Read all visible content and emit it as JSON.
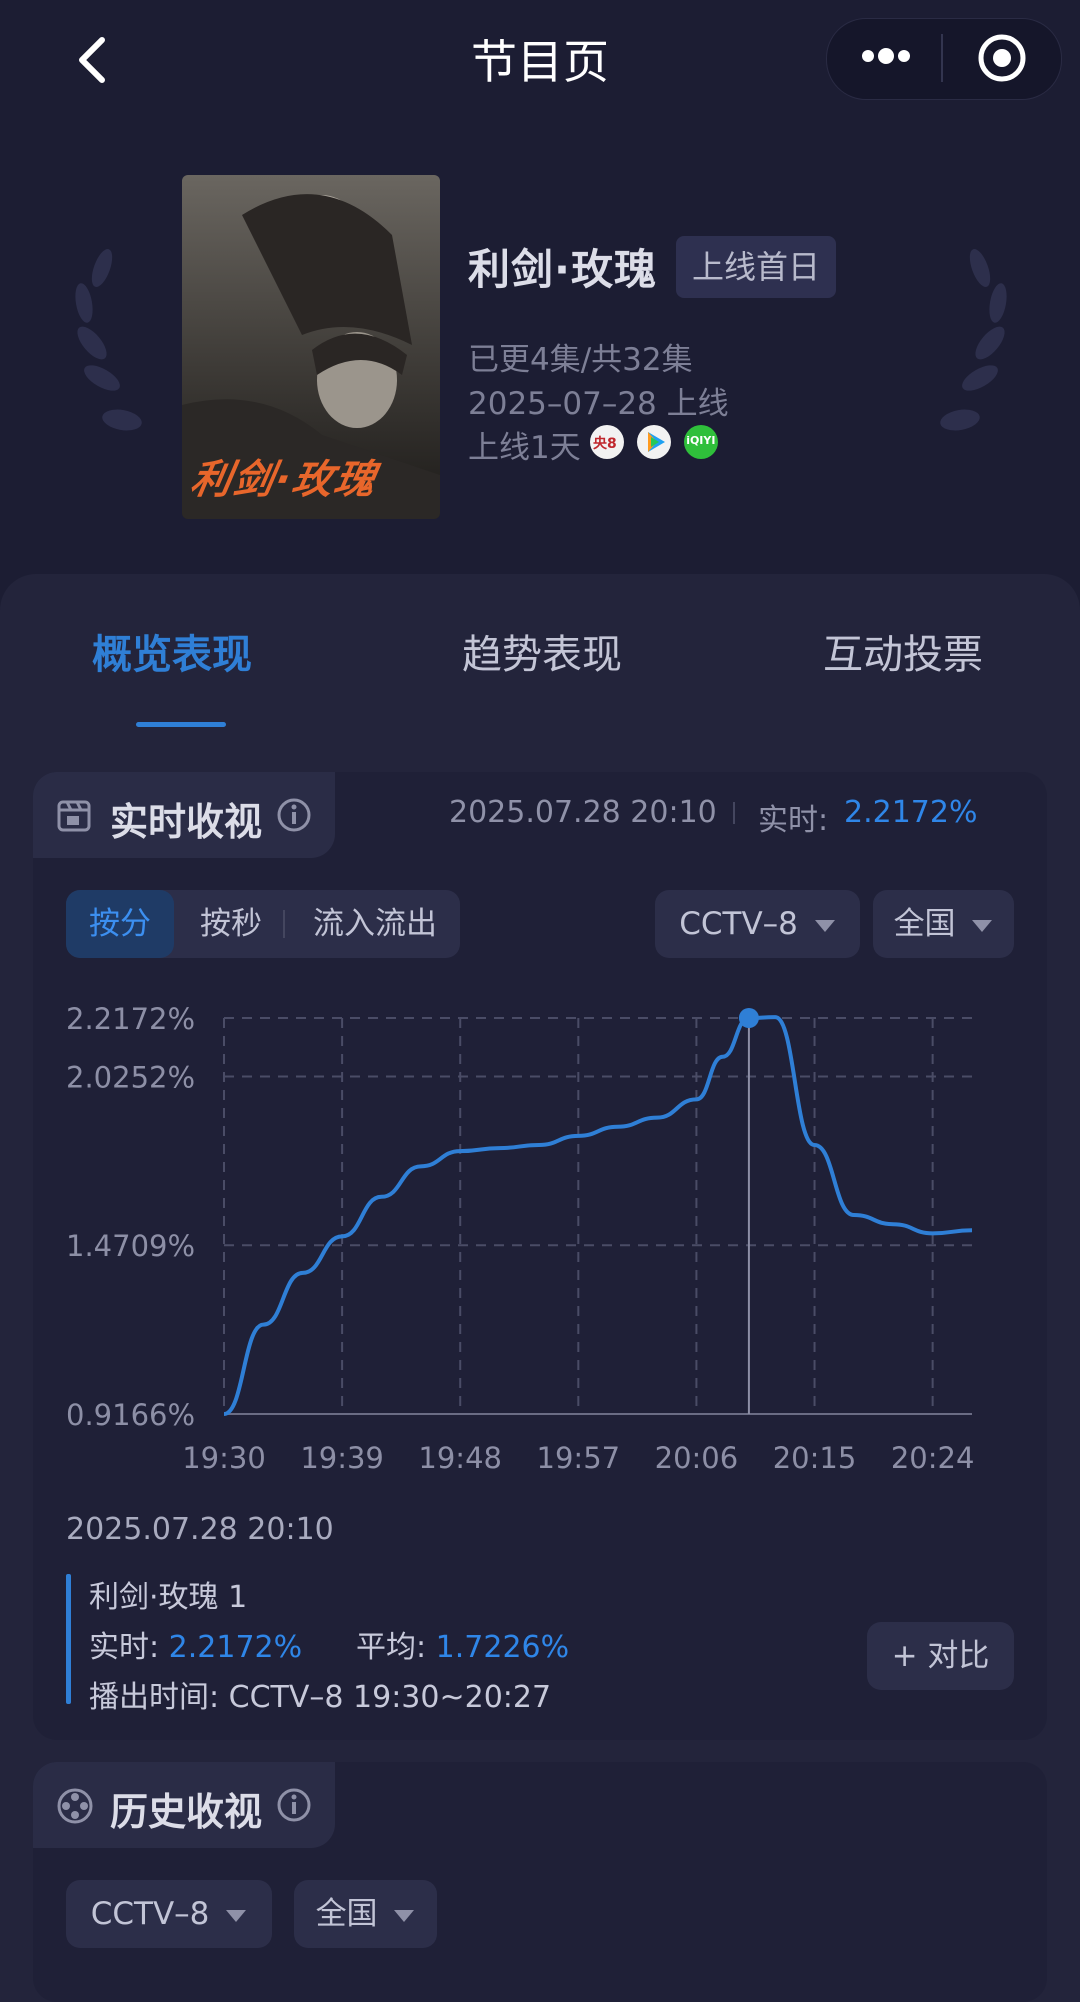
{
  "nav": {
    "title": "节目页",
    "back_icon": "chevron-left-icon",
    "more_icon": "more-icon",
    "close_icon": "target-icon"
  },
  "show": {
    "title": "利剑·玫瑰",
    "badge": "上线首日",
    "poster_title": "利剑·玫瑰",
    "episodes": "已更4集/共32集",
    "release": "2025–07–28 上线",
    "days_online": "上线1天",
    "platforms": [
      {
        "icon": "cctv8-icon",
        "label": "央8"
      },
      {
        "icon": "tencent-video-icon",
        "label": ""
      },
      {
        "icon": "iqiyi-icon",
        "label": "iQIYI"
      }
    ]
  },
  "tabs": [
    "概览表现",
    "趋势表现",
    "互动投票"
  ],
  "realtime": {
    "title": "实时收视",
    "timestamp": "2025.07.28 20:10",
    "realtime_label": "实时:",
    "realtime_value": "2.2172%",
    "segments": [
      "按分",
      "按秒",
      "流入流出"
    ],
    "channel": "CCTV–8",
    "region": "全国",
    "detail_time": "2025.07.28 20:10",
    "episode": "利剑·玫瑰 1",
    "rt_label": "实时:",
    "rt_value": "2.2172%",
    "avg_label": "平均:",
    "avg_value": "1.7226%",
    "airtime_label": "播出时间:",
    "airtime_value": "CCTV–8 19:30~20:27",
    "compare_button": "+ 对比"
  },
  "history": {
    "title": "历史收视",
    "channel": "CCTV–8",
    "region": "全国"
  },
  "chart_data": {
    "type": "line",
    "x": [
      "19:30",
      "19:33",
      "19:36",
      "19:39",
      "19:42",
      "19:45",
      "19:48",
      "19:51",
      "19:54",
      "19:57",
      "20:00",
      "20:03",
      "20:06",
      "20:08",
      "20:10",
      "20:12",
      "20:15",
      "20:18",
      "20:21",
      "20:24",
      "20:27"
    ],
    "series": [
      {
        "values": [
          0.9166,
          1.21,
          1.38,
          1.5,
          1.63,
          1.73,
          1.78,
          1.79,
          1.8,
          1.83,
          1.86,
          1.89,
          1.95,
          2.09,
          2.2172,
          2.22,
          1.8,
          1.57,
          1.54,
          1.51,
          1.52
        ]
      }
    ],
    "xticks": [
      "19:30",
      "19:39",
      "19:48",
      "19:57",
      "20:06",
      "20:15",
      "20:24"
    ],
    "yticks": [
      "0.9166%",
      "1.4709%",
      "2.0252%",
      "2.2172%"
    ],
    "ytick_values": [
      0.9166,
      1.4709,
      2.0252,
      2.2172
    ],
    "ylim": [
      0.9166,
      2.2172
    ],
    "highlight": {
      "x": "20:10",
      "y": 2.2172
    },
    "line_color": "#2f7fd6",
    "grid": true
  },
  "colors": {
    "accent": "#2f7fd6",
    "background": "#1c1d33",
    "card": "#23243b"
  }
}
